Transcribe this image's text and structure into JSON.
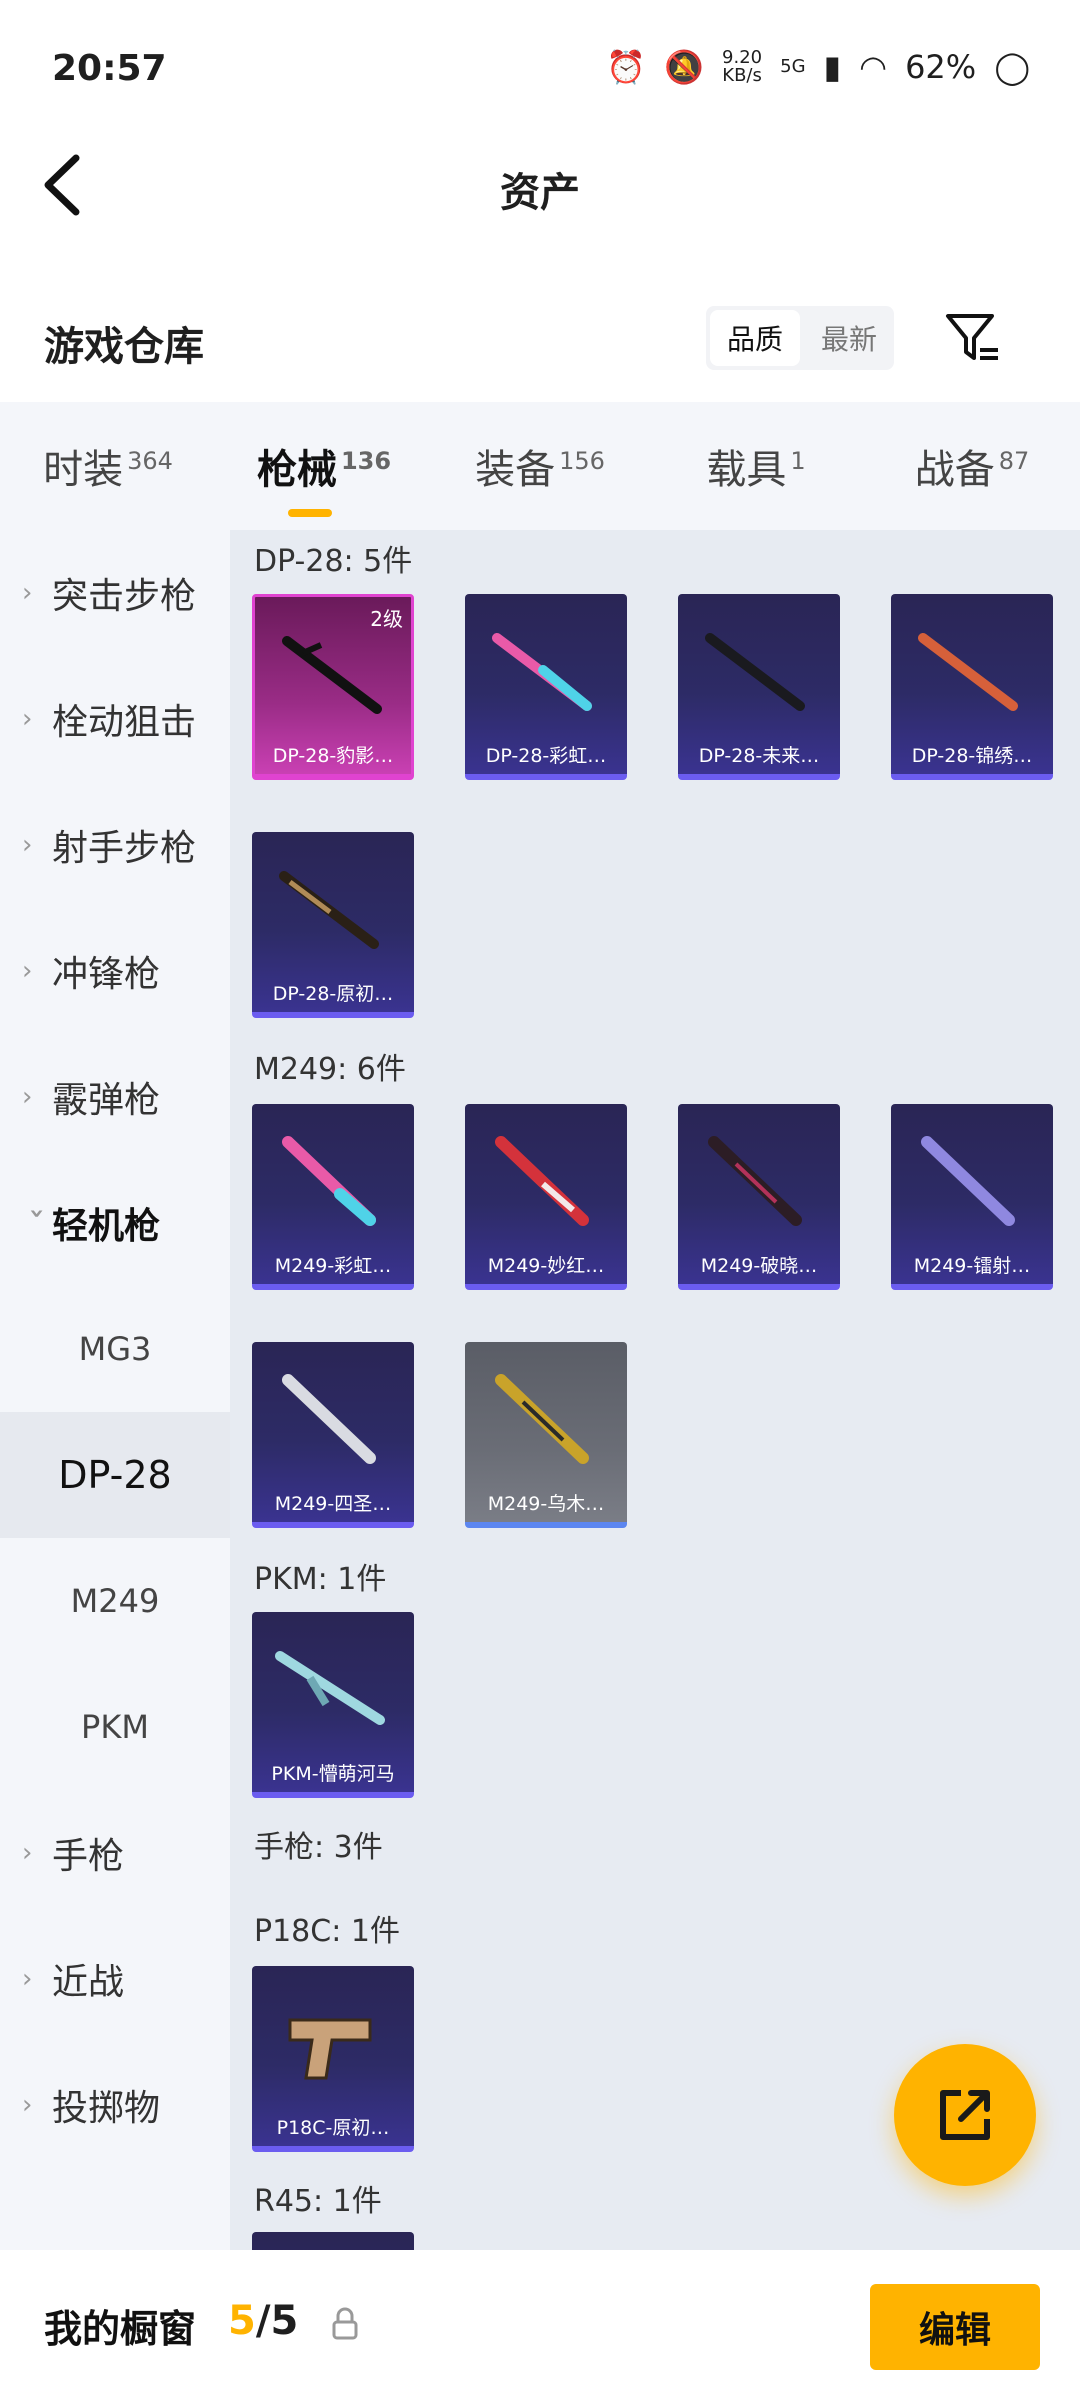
{
  "status": {
    "time": "20:57",
    "net_speed_value": "9.20",
    "net_speed_unit": "KB/s",
    "signal_label": "5G",
    "battery": "62%"
  },
  "header": {
    "title": "资产"
  },
  "warehouse": {
    "title": "游戏仓库",
    "sort_quality": "品质",
    "sort_new": "最新"
  },
  "tabs": [
    {
      "label": "时装",
      "count": "364"
    },
    {
      "label": "枪械",
      "count": "136"
    },
    {
      "label": "装备",
      "count": "156"
    },
    {
      "label": "载具",
      "count": "1"
    },
    {
      "label": "战备",
      "count": "87"
    }
  ],
  "sidebar": {
    "items": [
      "突击步枪",
      "栓动狙击",
      "射手步枪",
      "冲锋枪",
      "霰弹枪",
      "轻机枪"
    ],
    "sub": [
      "MG3",
      "DP-28",
      "M249",
      "PKM"
    ],
    "after": [
      "手枪",
      "近战",
      "投掷物"
    ]
  },
  "groups": {
    "dp28": "DP-28: 5件",
    "m249": "M249: 6件",
    "pkm": "PKM: 1件",
    "pistol": "手枪: 3件",
    "p18c": "P18C: 1件",
    "r45": "R45: 1件"
  },
  "cards": {
    "dp28": [
      {
        "label": "DP-28-豹影…",
        "level": "2级"
      },
      {
        "label": "DP-28-彩虹…"
      },
      {
        "label": "DP-28-未来…"
      },
      {
        "label": "DP-28-锦绣…"
      },
      {
        "label": "DP-28-原初…"
      }
    ],
    "m249": [
      {
        "label": "M249-彩虹…"
      },
      {
        "label": "M249-妙红…"
      },
      {
        "label": "M249-破晓…"
      },
      {
        "label": "M249-镭射…"
      },
      {
        "label": "M249-四圣…"
      },
      {
        "label": "M249-乌木…"
      }
    ],
    "pkm": [
      {
        "label": "PKM-懵萌河马"
      }
    ],
    "p18c": [
      {
        "label": "P18C-原初…"
      }
    ]
  },
  "bottom": {
    "label": "我的橱窗",
    "current": "5",
    "total": "/5",
    "edit": "编辑"
  },
  "colors": {
    "accent": "#ffb300"
  }
}
